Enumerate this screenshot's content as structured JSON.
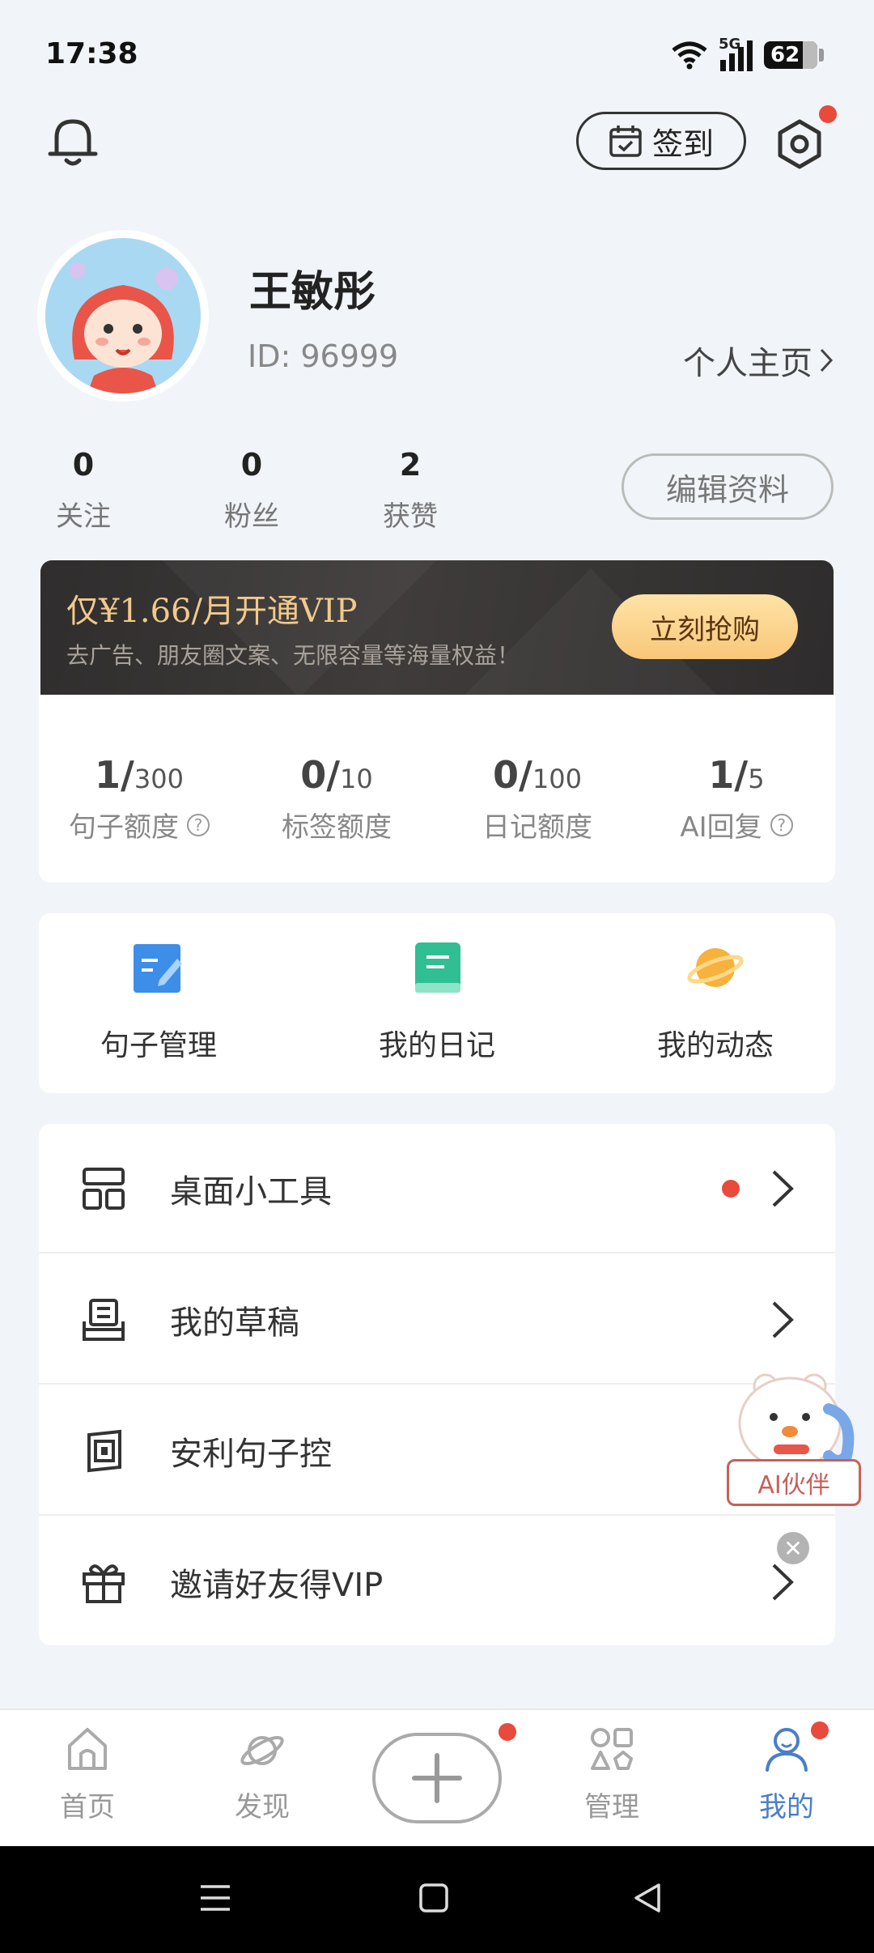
{
  "status_bar": {
    "time": "17:38",
    "network": "5G",
    "battery": "62"
  },
  "header": {
    "checkin_label": "签到"
  },
  "profile": {
    "name": "王敏彤",
    "id_text": "ID: 96999",
    "homepage_label": "个人主页",
    "stats": [
      {
        "value": "0",
        "label": "关注"
      },
      {
        "value": "0",
        "label": "粉丝"
      },
      {
        "value": "2",
        "label": "获赞"
      }
    ],
    "edit_label": "编辑资料"
  },
  "vip_banner": {
    "title": "仅¥1.66/月开通VIP",
    "subtitle": "去广告、朋友圈文案、无限容量等海量权益！",
    "button": "立刻抢购"
  },
  "quotas": [
    {
      "used": "1/",
      "max": "300",
      "label": "句子额度",
      "help": true
    },
    {
      "used": "0/",
      "max": "10",
      "label": "标签额度",
      "help": false
    },
    {
      "used": "0/",
      "max": "100",
      "label": "日记额度",
      "help": false
    },
    {
      "used": "1/",
      "max": "5",
      "label": "AI回复",
      "help": true
    }
  ],
  "shortcuts": [
    {
      "label": "句子管理",
      "icon": "edit-note-icon"
    },
    {
      "label": "我的日记",
      "icon": "diary-book-icon"
    },
    {
      "label": "我的动态",
      "icon": "planet-icon"
    }
  ],
  "menu": [
    {
      "label": "桌面小工具",
      "icon": "widget-grid-icon",
      "dot": true
    },
    {
      "label": "我的草稿",
      "icon": "draft-inbox-icon",
      "dot": false
    },
    {
      "label": "安利句子控",
      "icon": "recommend-icon",
      "dot": false
    },
    {
      "label": "邀请好友得VIP",
      "icon": "gift-icon",
      "dot": false
    }
  ],
  "ai_companion": {
    "label": "AI伙伴"
  },
  "tabs": [
    {
      "label": "首页",
      "icon": "home-icon"
    },
    {
      "label": "发现",
      "icon": "discover-planet-icon"
    },
    {
      "label": "管理",
      "icon": "manage-shapes-icon"
    },
    {
      "label": "我的",
      "icon": "user-icon",
      "active": true
    }
  ],
  "colors": {
    "accent": "#4a7ec8",
    "notify": "#e84a3c",
    "vip_gold": "#f2c98b"
  }
}
